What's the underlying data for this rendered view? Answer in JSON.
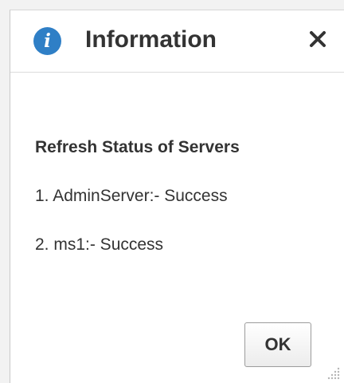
{
  "dialog": {
    "title": "Information",
    "icon": "info-icon",
    "close_icon": "close-icon",
    "heading": "Refresh Status of Servers",
    "lines": [
      "1. AdminServer:- Success",
      "2. ms1:- Success"
    ],
    "ok_label": "OK"
  },
  "colors": {
    "info_icon": "#2f7fc6",
    "text": "#333333",
    "background": "#ffffff"
  }
}
